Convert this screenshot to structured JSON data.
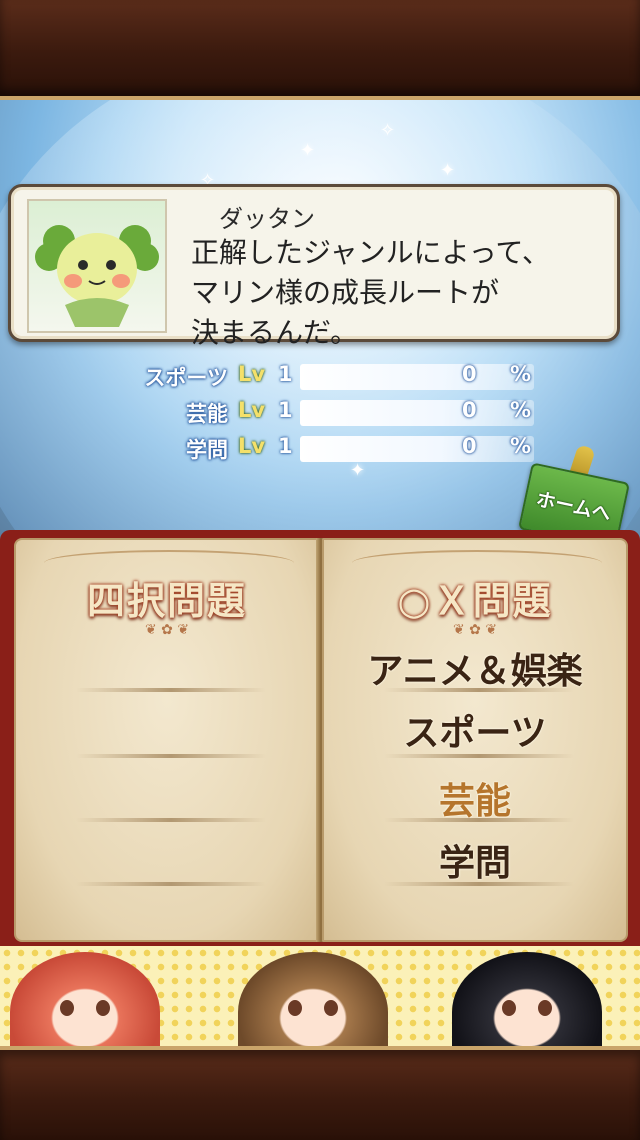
{
  "dialog": {
    "speaker": "ダッタン",
    "lines": [
      "正解したジャンルによって、",
      "マリン様の成長ルートが",
      "決まるんだ。"
    ]
  },
  "stats": [
    {
      "name": "スポーツ",
      "lv_label": "Lv",
      "level": "1",
      "percent": "0",
      "percent_sign": "%"
    },
    {
      "name": "芸能",
      "lv_label": "Lv",
      "level": "1",
      "percent": "0",
      "percent_sign": "%"
    },
    {
      "name": "学問",
      "lv_label": "Lv",
      "level": "1",
      "percent": "0",
      "percent_sign": "%"
    }
  ],
  "home_button": {
    "label": "ホームへ"
  },
  "book": {
    "left": {
      "title": "四択問題"
    },
    "right": {
      "title": "○Ｘ問題",
      "categories": [
        {
          "label": "アニメ＆娯楽"
        },
        {
          "label": "スポーツ"
        },
        {
          "label": "芸能"
        },
        {
          "label": "学問"
        }
      ]
    }
  },
  "colors": {
    "book_cover": "#8a1f18",
    "page": "#ecdcbc",
    "title_outline": "#a8472a",
    "stat_glow": "#2a5aa0",
    "home_green": "#4f9e37"
  }
}
